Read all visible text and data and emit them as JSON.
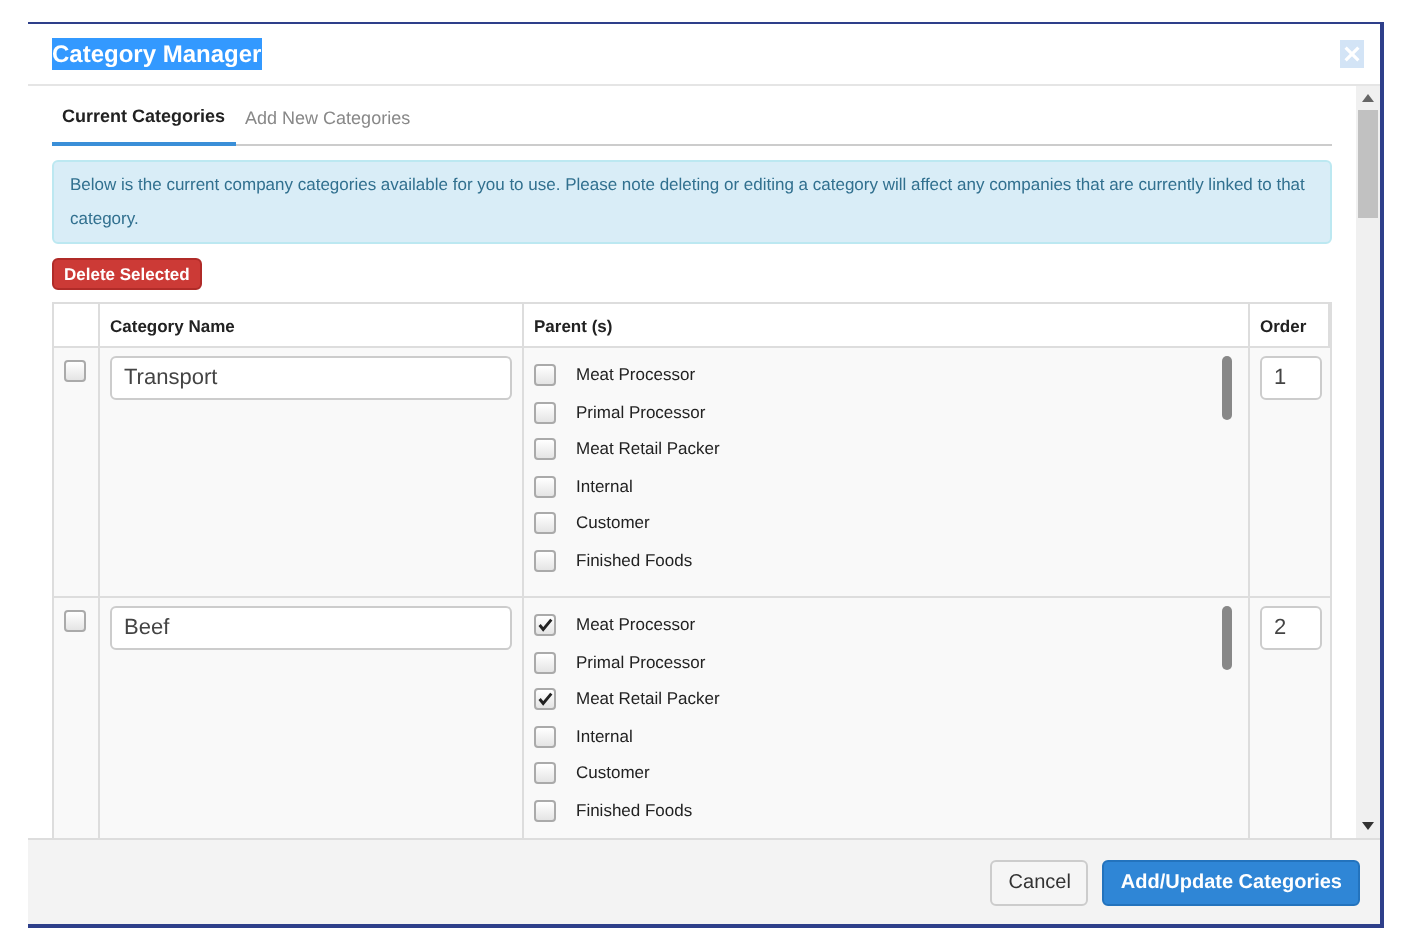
{
  "dialog": {
    "title": "Category Manager",
    "tabs": [
      {
        "label": "Current Categories",
        "selected": true
      },
      {
        "label": "Add New Categories",
        "selected": false
      }
    ],
    "info": "Below is the current company categories available for you to use. Please note deleting or editing a category will affect any companies that are currently linked to that category.",
    "delete_button": "Delete Selected",
    "table": {
      "columns": [
        "Category Name",
        "Parent (s)",
        "Order"
      ],
      "rows": [
        {
          "checked": false,
          "name": "Transport",
          "order": "1",
          "parents": [
            {
              "label": "Meat Processor",
              "checked": false
            },
            {
              "label": "Primal Processor",
              "checked": false
            },
            {
              "label": "Meat Retail Packer",
              "checked": false
            },
            {
              "label": "Internal",
              "checked": false
            },
            {
              "label": "Customer",
              "checked": false
            },
            {
              "label": "Finished Foods",
              "checked": false
            }
          ]
        },
        {
          "checked": false,
          "name": "Beef",
          "order": "2",
          "parents": [
            {
              "label": "Meat Processor",
              "checked": true
            },
            {
              "label": "Primal Processor",
              "checked": false
            },
            {
              "label": "Meat Retail Packer",
              "checked": true
            },
            {
              "label": "Internal",
              "checked": false
            },
            {
              "label": "Customer",
              "checked": false
            },
            {
              "label": "Finished Foods",
              "checked": false
            }
          ]
        }
      ]
    },
    "buttons": {
      "cancel": "Cancel",
      "submit": "Add/Update Categories"
    }
  }
}
